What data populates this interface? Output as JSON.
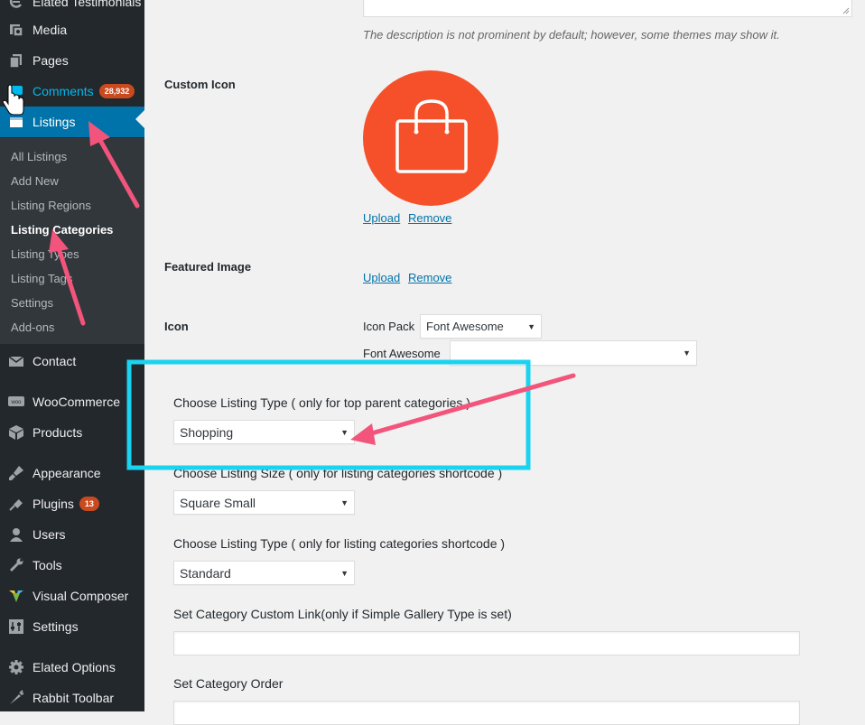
{
  "sidebar": {
    "items": [
      {
        "label": "Elated Testimonials",
        "icon": "elated-icon"
      },
      {
        "label": "Media",
        "icon": "media-icon"
      },
      {
        "label": "Pages",
        "icon": "pages-icon"
      },
      {
        "label": "Comments",
        "icon": "comments-icon",
        "badge": "28,932"
      },
      {
        "label": "Listings",
        "icon": "listings-icon"
      },
      {
        "label": "Contact",
        "icon": "mail-icon"
      },
      {
        "label": "WooCommerce",
        "icon": "woo-icon"
      },
      {
        "label": "Products",
        "icon": "products-icon"
      },
      {
        "label": "Appearance",
        "icon": "brush-icon"
      },
      {
        "label": "Plugins",
        "icon": "plugin-icon",
        "badge": "13"
      },
      {
        "label": "Users",
        "icon": "users-icon"
      },
      {
        "label": "Tools",
        "icon": "wrench-icon"
      },
      {
        "label": "Visual Composer",
        "icon": "vc-icon"
      },
      {
        "label": "Settings",
        "icon": "settings-icon"
      },
      {
        "label": "Elated Options",
        "icon": "gear-icon"
      },
      {
        "label": "Rabbit Toolbar",
        "icon": "carrot-icon"
      }
    ],
    "submenu": [
      "All Listings",
      "Add New",
      "Listing Regions",
      "Listing Categories",
      "Listing Types",
      "Listing Tags",
      "Settings",
      "Add-ons"
    ]
  },
  "form": {
    "description_note": "The description is not prominent by default; however, some themes may show it.",
    "custom_icon_label": "Custom Icon",
    "upload_label": "Upload",
    "remove_label": "Remove",
    "featured_image_label": "Featured Image",
    "icon_label": "Icon",
    "icon_pack_label": "Icon Pack",
    "icon_pack_value": "Font Awesome",
    "font_awesome_label": "Font Awesome",
    "font_awesome_value": "",
    "listing_type_top_label": "Choose Listing Type ( only for top parent categories )",
    "listing_type_top_value": "Shopping",
    "listing_size_label": "Choose Listing Size ( only for listing categories shortcode )",
    "listing_size_value": "Square Small",
    "listing_type_shortcode_label": "Choose Listing Type ( only for listing categories shortcode )",
    "listing_type_shortcode_value": "Standard",
    "custom_link_label": "Set Category Custom Link(only if Simple Gallery Type is set)",
    "custom_link_value": "",
    "category_order_label": "Set Category Order",
    "category_order_value": ""
  },
  "colors": {
    "sidebar_bg": "#23282d",
    "submenu_bg": "#32373c",
    "current_bg": "#0073aa",
    "icon_circle": "#f5502a",
    "annotation_arrow": "#f2547b",
    "highlight_box": "#1ad3f0",
    "badge": "#ca4a1f"
  }
}
